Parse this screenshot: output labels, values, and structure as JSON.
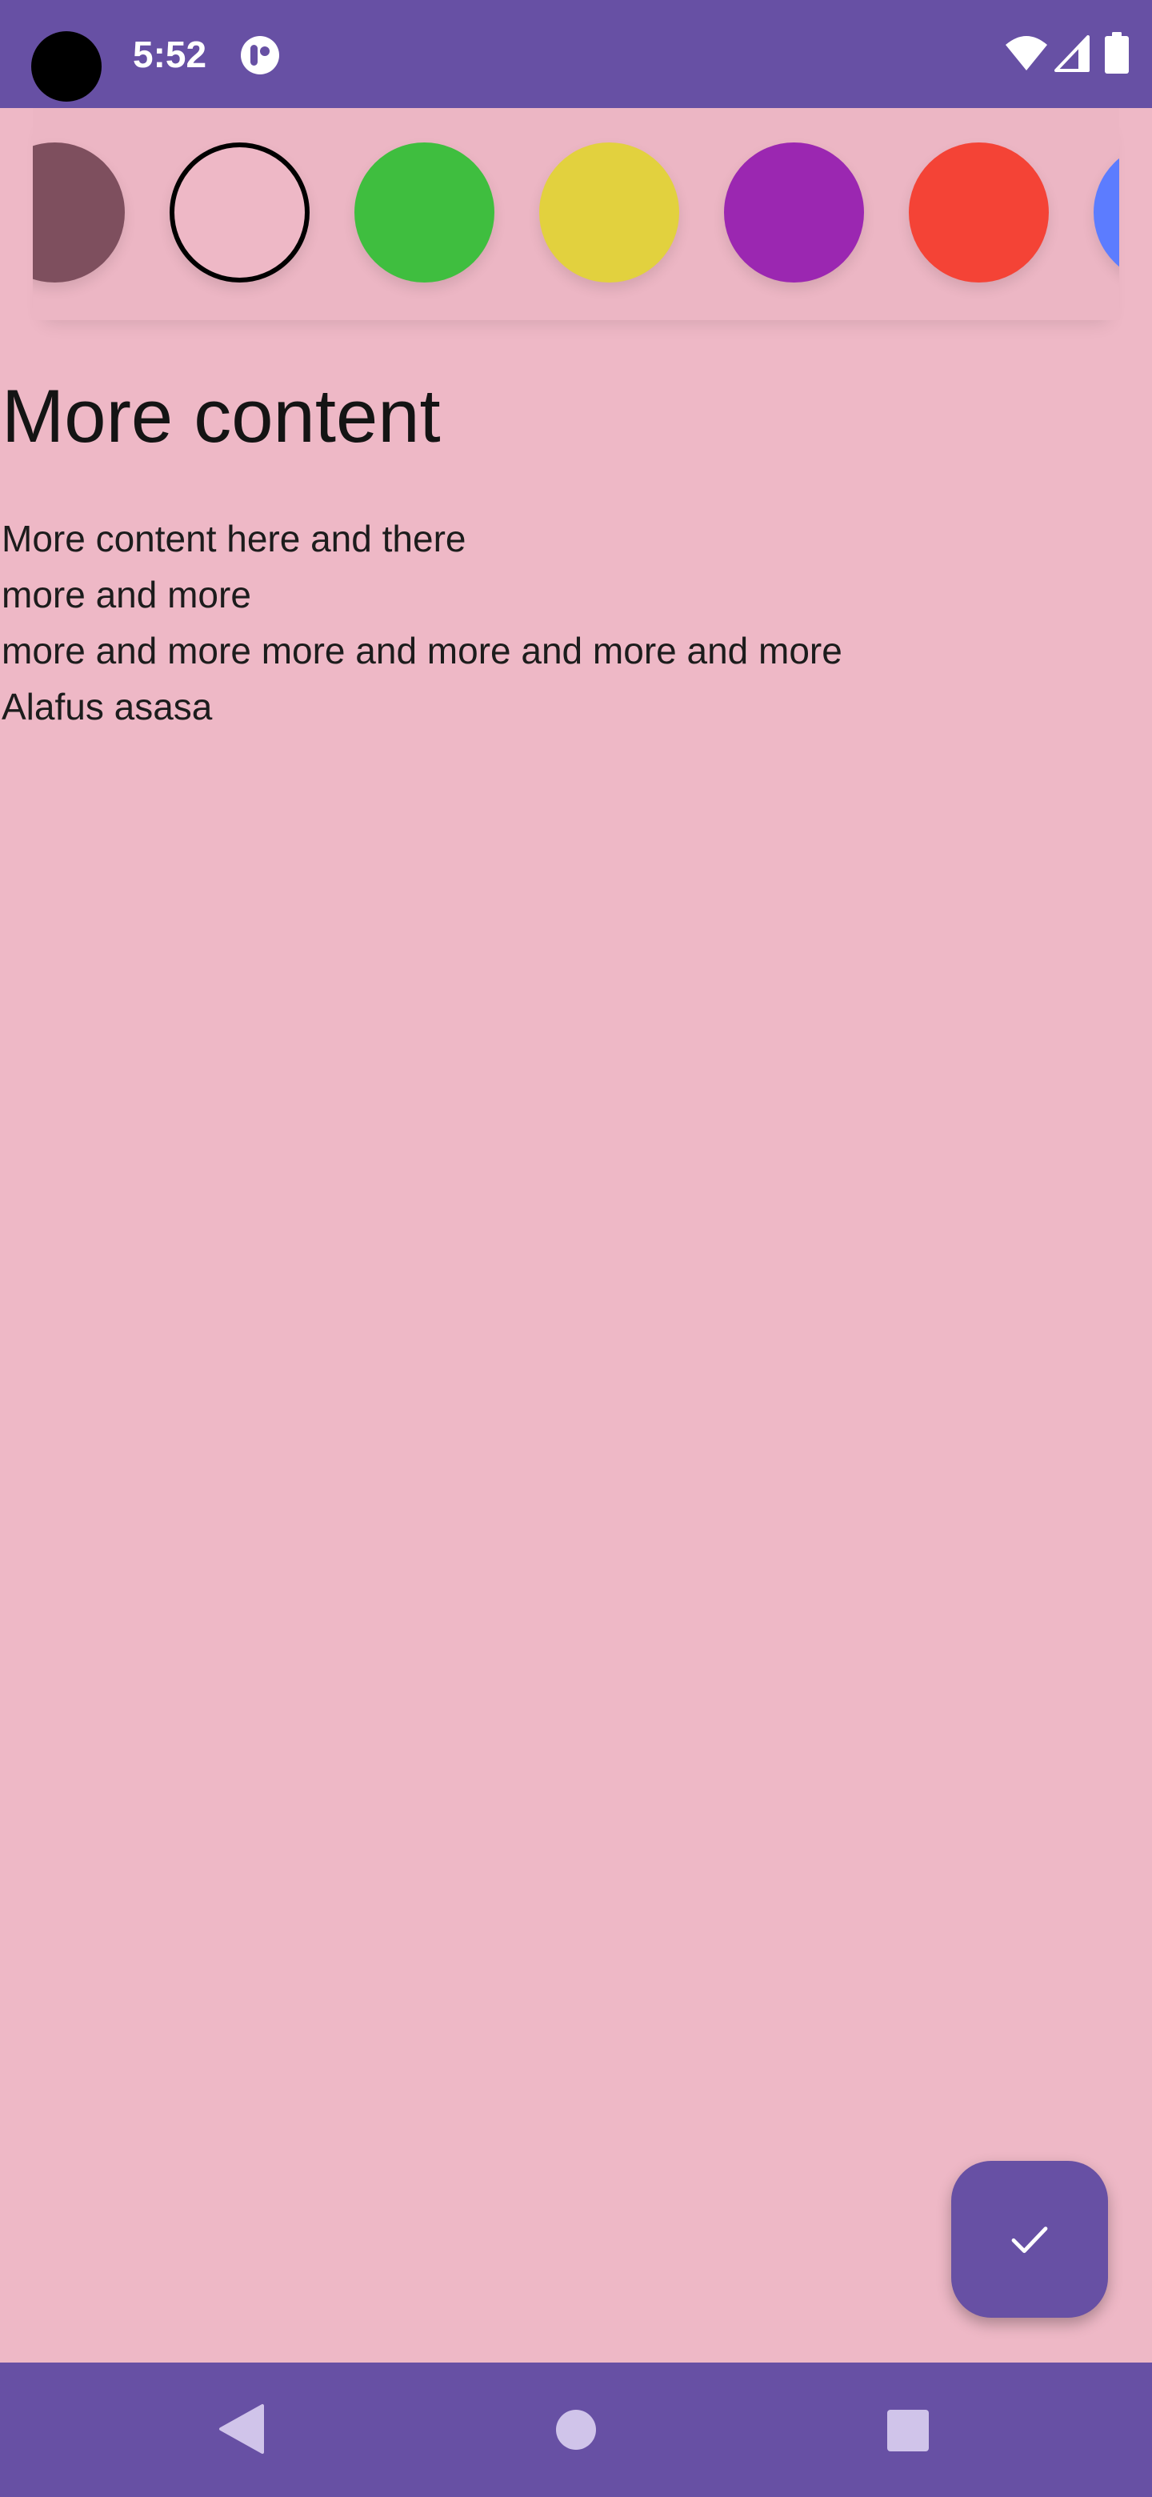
{
  "status_bar": {
    "time": "5:52",
    "background": "#6750a4",
    "icons": [
      "camera-cutout",
      "notification-app-icon",
      "wifi-icon",
      "cellular-signal-icon",
      "battery-icon"
    ]
  },
  "color_picker": {
    "selected_index": 1,
    "swatches": [
      {
        "color": "#7e4f5e",
        "selected": false
      },
      {
        "color": "#eeb8c6",
        "selected": true
      },
      {
        "color": "#3fbe3f",
        "selected": false
      },
      {
        "color": "#e2d13e",
        "selected": false
      },
      {
        "color": "#9b27b1",
        "selected": false
      },
      {
        "color": "#f44336",
        "selected": false
      },
      {
        "color": "#5c7cff",
        "selected": false
      }
    ]
  },
  "note": {
    "title": "More content",
    "body_lines": [
      "More content here and there",
      "more and more",
      "more and more more and more and more and more",
      "Alafus asasa"
    ],
    "background": "#eeb8c6"
  },
  "fab": {
    "icon": "check-icon",
    "color": "#6750a4"
  },
  "nav_bar": {
    "icons": [
      "back-icon",
      "home-icon",
      "recents-icon"
    ]
  }
}
